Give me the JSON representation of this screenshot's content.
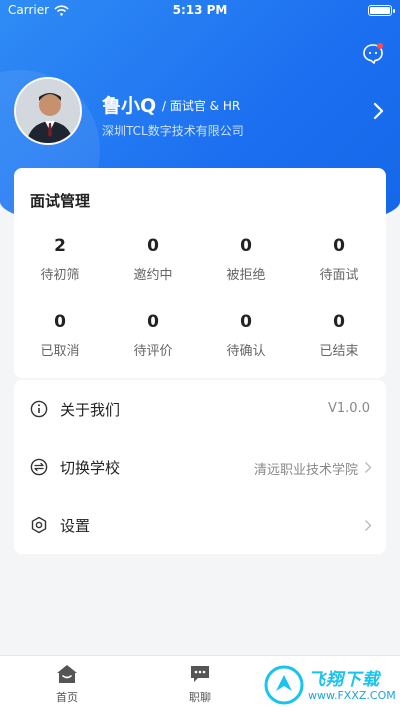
{
  "status_bar": {
    "carrier": "Carrier",
    "time": "5:13 PM"
  },
  "profile": {
    "name": "鲁小Q",
    "role": "/ 面试官 & HR",
    "company": "深圳TCL数字技术有限公司"
  },
  "interview": {
    "title": "面试管理",
    "stats": [
      {
        "value": "2",
        "label": "待初筛"
      },
      {
        "value": "0",
        "label": "邀约中"
      },
      {
        "value": "0",
        "label": "被拒绝"
      },
      {
        "value": "0",
        "label": "待面试"
      },
      {
        "value": "0",
        "label": "已取消"
      },
      {
        "value": "0",
        "label": "待评价"
      },
      {
        "value": "0",
        "label": "待确认"
      },
      {
        "value": "0",
        "label": "已结束"
      }
    ]
  },
  "menu": {
    "about": {
      "label": "关于我们",
      "value": "V1.0.0"
    },
    "switch_school": {
      "label": "切换学校",
      "value": "清远职业技术学院"
    },
    "settings": {
      "label": "设置"
    }
  },
  "tabbar": {
    "home": "首页",
    "jobs": "职聊"
  },
  "watermark": {
    "title": "飞翔下载",
    "url": "www.FXXZ.COM"
  },
  "colors": {
    "brand_blue": "#1c6ff0",
    "badge_red": "#ff4d4f",
    "watermark": "#17c3f0"
  }
}
